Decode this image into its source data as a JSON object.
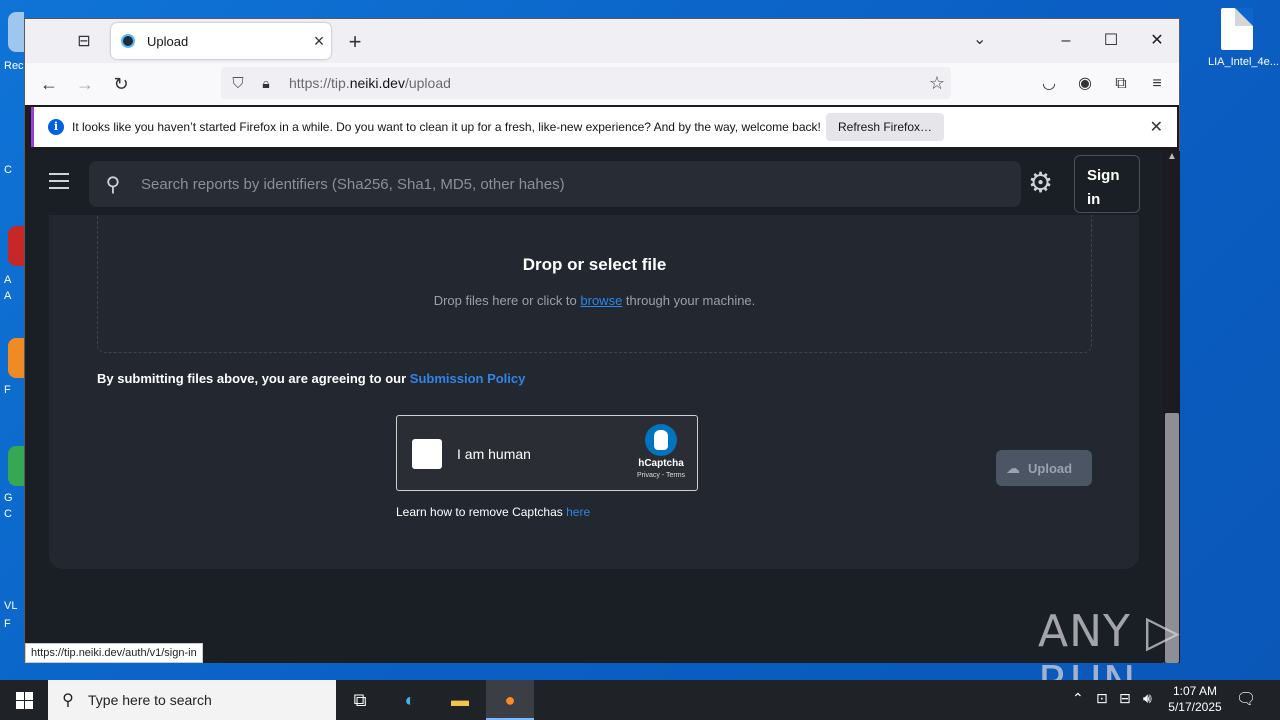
{
  "desktop": {
    "file_label": "LIA_Intel_4e...",
    "left_labels": [
      "Rec",
      "C",
      "A",
      "A",
      "F",
      "G",
      "C",
      "VL",
      "F"
    ]
  },
  "browser": {
    "tab_title": "Upload",
    "url_domain_prefix": "https://tip.",
    "url_domain": "neiki.dev",
    "url_path": "/upload",
    "notice_text": "It looks like you haven’t started Firefox in a while. Do you want to clean it up for a fresh, like-new experience? And by the way, welcome back!",
    "notice_button": "Refresh Firefox…",
    "status_url": "https://tip.neiki.dev/auth/v1/sign-in"
  },
  "site": {
    "search_placeholder": "Search reports by identifiers (Sha256, Sha1, MD5, other hahes)",
    "signin_line1": "Sign",
    "signin_line2": "in",
    "drop_title": "Drop or select file",
    "drop_sub_before": "Drop files here or click to ",
    "drop_sub_link": "browse",
    "drop_sub_after": " through your machine.",
    "policy_text": "By submitting files above, you are agreeing to our ",
    "policy_link": "Submission Policy",
    "captcha_label": "I am human",
    "captcha_brand": "hCaptcha",
    "captcha_links": "Privacy - Terms",
    "learn_text": "Learn how to remove Captchas ",
    "learn_link": "here",
    "upload_label": "Upload"
  },
  "watermark": "ANY ▷ RUN",
  "taskbar": {
    "search_placeholder": "Type here to search",
    "time": "1:07 AM",
    "date": "5/17/2025"
  },
  "colors": {
    "page_bg": "#1a1e25",
    "card_bg": "#222730",
    "link": "#2d86e6",
    "desktop": "#0b5fc4"
  }
}
